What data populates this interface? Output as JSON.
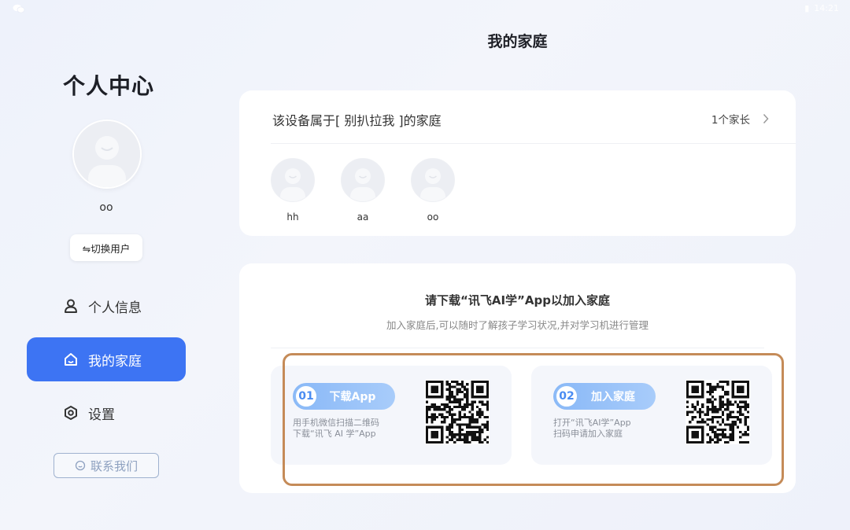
{
  "status_bar": {
    "time": "14:21",
    "battery": "▮"
  },
  "sidebar": {
    "title": "个人中心",
    "user_name": "oo",
    "switch_user_label": "⇋切换用户",
    "nav": [
      {
        "label": "个人信息",
        "icon": "person-icon",
        "active": false
      },
      {
        "label": "我的家庭",
        "icon": "home-icon",
        "active": true
      },
      {
        "label": "设置",
        "icon": "settings-icon",
        "active": false
      }
    ],
    "contact_label": "联系我们"
  },
  "page": {
    "title": "我的家庭"
  },
  "family_card": {
    "owner_text": "该设备属于[ 别扒拉我 ]的家庭",
    "parent_count": "1个家长",
    "members": [
      {
        "name": "hh"
      },
      {
        "name": "aa"
      },
      {
        "name": "oo"
      }
    ]
  },
  "join_card": {
    "headline": "请下载“讯飞AI学”App以加入家庭",
    "subtitle": "加入家庭后,可以随时了解孩子学习状况,并对学习机进行管理",
    "steps": [
      {
        "num": "01",
        "label": "下载App",
        "desc_line1": "用手机微信扫描二维码",
        "desc_line2": "下载“讯飞 AI 学”App"
      },
      {
        "num": "02",
        "label": "加入家庭",
        "desc_line1": "打开“讯飞AI学”App",
        "desc_line2": "扫码申请加入家庭"
      }
    ]
  },
  "colors": {
    "accent": "#3d74f3",
    "highlight_border": "#c58b58",
    "pill": "#89b8f7"
  }
}
